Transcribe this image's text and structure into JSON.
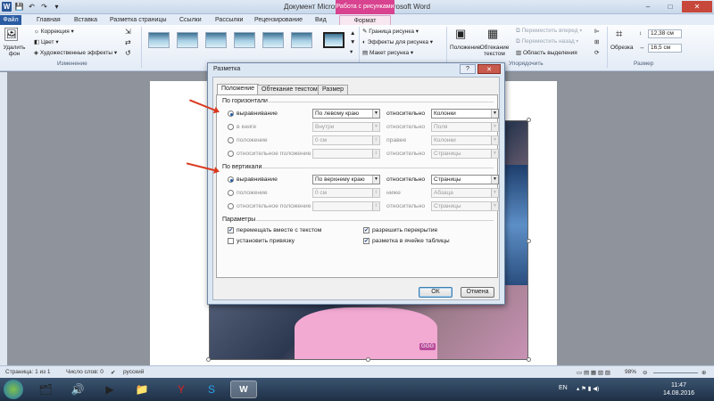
{
  "window": {
    "title": "Документ Microsoft Word (2) - Microsoft Word",
    "context_tab_group": "Работа с рисунками"
  },
  "tabs": [
    "Файл",
    "Главная",
    "Вставка",
    "Разметка страницы",
    "Ссылки",
    "Рассылки",
    "Рецензирование",
    "Вид",
    "Формат"
  ],
  "ribbon": {
    "remove_bg": "Удалить фон",
    "correction": "Коррекция",
    "color": "Цвет",
    "art_effects": "Художественные эффекты",
    "group_change": "Изменение",
    "border": "Граница рисунка",
    "effects": "Эффекты для рисунка",
    "layout": "Макет рисунка",
    "position": "Положение",
    "wrap": "Обтекание текстом",
    "forward": "Переместить вперед",
    "backward": "Переместить назад",
    "selection_pane": "Область выделения",
    "group_arrange": "Упорядочить",
    "crop": "Обрезка",
    "height": "12,38 см",
    "width": "16,5 см",
    "group_size": "Размер"
  },
  "dialog": {
    "title": "Разметка",
    "help": "?",
    "tabs": [
      "Положение",
      "Обтекание текстом",
      "Размер"
    ],
    "horizontal": {
      "header": "По горизонтали",
      "rows": [
        {
          "label": "выравнивание",
          "value": "По левому краю",
          "rel": "относительно",
          "target": "Колонки"
        },
        {
          "label": "в книге",
          "value": "Внутри",
          "rel": "относительно",
          "target": "Поля"
        },
        {
          "label": "положение",
          "value": "0 см",
          "rel": "правее",
          "target": "Колонки"
        },
        {
          "label": "относительное положение",
          "value": "",
          "rel": "относительно",
          "target": "Страницы"
        }
      ]
    },
    "vertical": {
      "header": "По вертикали",
      "rows": [
        {
          "label": "выравнивание",
          "value": "По верхнему краю",
          "rel": "относительно",
          "target": "Страницы"
        },
        {
          "label": "положение",
          "value": "0 см",
          "rel": "ниже",
          "target": "Абзаца"
        },
        {
          "label": "относительное положение",
          "value": "",
          "rel": "относительно",
          "target": "Страницы"
        }
      ]
    },
    "params": {
      "header": "Параметры",
      "move_with_text": "перемещать вместе с текстом",
      "lock_anchor": "установить привязку",
      "allow_overlap": "разрешить перекрытие",
      "layout_in_cell": "разметка в ячейке таблицы"
    },
    "ok": "ОК",
    "cancel": "Отмена"
  },
  "status": {
    "page": "Страница: 1 из 1",
    "words": "Число слов: 0",
    "lang": "русский",
    "zoom": "98%"
  },
  "taskbar": {
    "lang": "EN",
    "time": "11:47",
    "date": "14.08.2016"
  },
  "picture": {
    "logo": "GGG"
  }
}
